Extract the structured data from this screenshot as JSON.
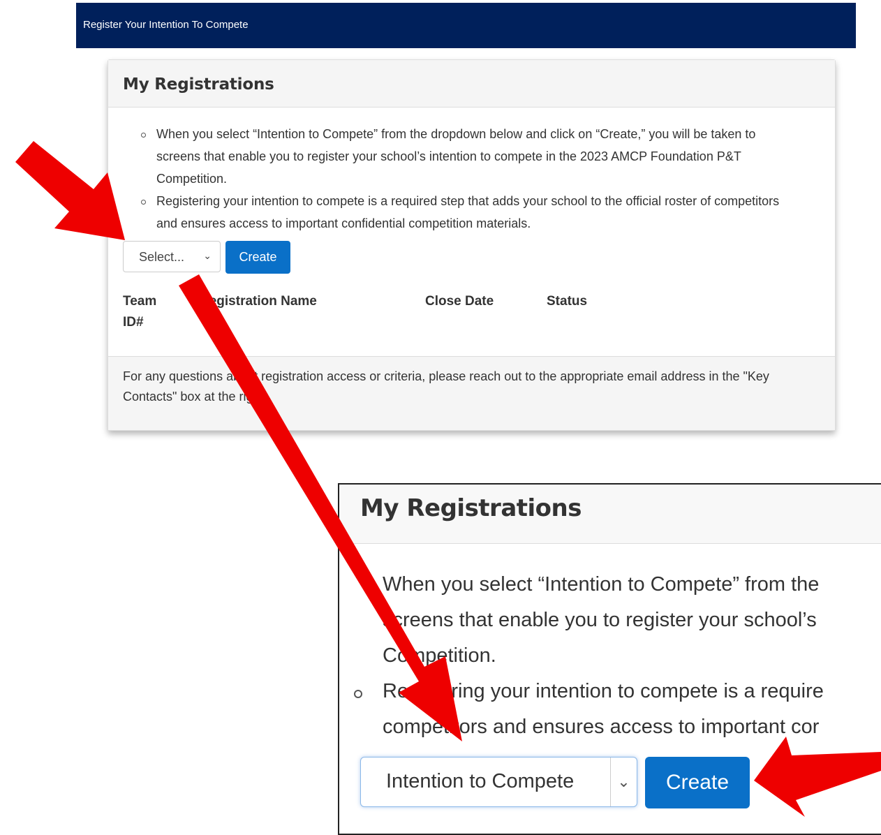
{
  "header": {
    "title": "Register Your Intention To Compete"
  },
  "panel": {
    "title": "My Registrations",
    "bullets": [
      "When you select “Intention to Compete” from the dropdown below and click on “Create,” you will be taken to screens that enable you to register your school’s intention to compete in the 2023 AMCP Foundation P&T Competition.",
      "Registering your intention to compete is a required step that adds your school to the official roster of competitors and ensures access to important confidential competition materials."
    ],
    "select": {
      "value": "Select..."
    },
    "create_label": "Create",
    "columns": {
      "team_id": "Team ID#",
      "registration_name": "Registration Name",
      "close_date": "Close Date",
      "status": "Status"
    },
    "footer": "For any questions about registration access or criteria, please reach out to the appropriate email address in the \"Key Contacts\" box at the right."
  },
  "zoom": {
    "title": "My Registrations",
    "lines": [
      "When you select “Intention to Compete” from the",
      "screens that enable you to register your school’s",
      "Competition.",
      "Registering your intention to compete is a require",
      "competitors and ensures access to important cor"
    ],
    "select": {
      "value": "Intention to Compete"
    },
    "create_label": "Create"
  },
  "icons": {
    "select_chevron": "chevron-down-icon",
    "annotation": "red-arrow-icon"
  },
  "colors": {
    "header_bg": "#00205b",
    "button_bg": "#0a70c8",
    "arrow": "#ee0000"
  }
}
